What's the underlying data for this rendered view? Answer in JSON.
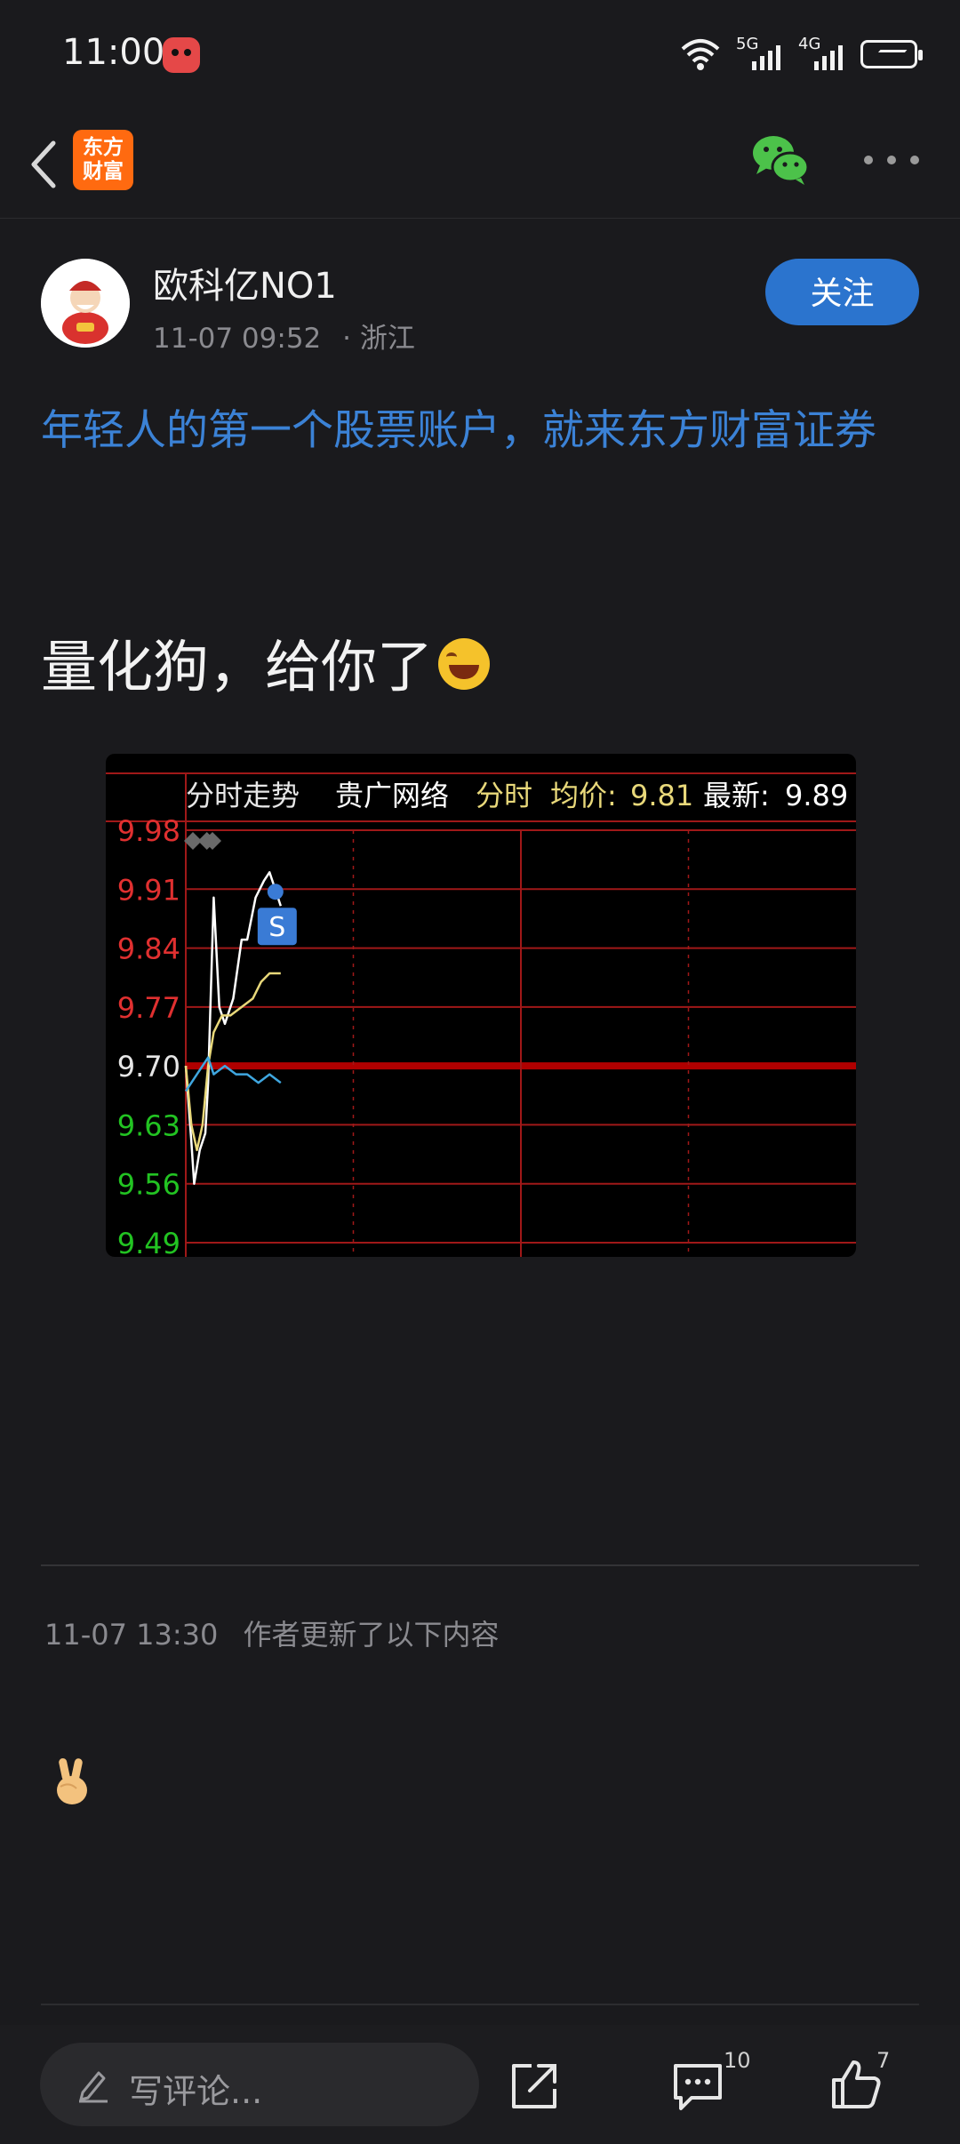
{
  "status_bar": {
    "time": "11:00",
    "network_1": "5G",
    "network_2": "4G"
  },
  "app_bar": {
    "logo_line1": "东方",
    "logo_line2": "财富",
    "brand_color": "#ff6a10"
  },
  "post": {
    "author_name": "欧科亿NO1",
    "timestamp": "11-07 09:52",
    "location": "· 浙江",
    "follow_label": "关注",
    "promo_link": "年轻人的第一个股票账户，就来东方财富证券",
    "body_text": "量化狗，给你了",
    "link_color": "#3b82d6"
  },
  "chart_data": {
    "type": "line",
    "title": "分时走势",
    "stock_name": "贵广网络",
    "mode_label": "分时",
    "avg_label": "均价:",
    "avg_value": "9.81",
    "latest_label": "最新:",
    "latest_value": "9.89",
    "trade_marker": "S",
    "y_ticks": [
      "9.98",
      "9.91",
      "9.84",
      "9.77",
      "9.70",
      "9.63",
      "9.56",
      "9.49"
    ],
    "reference_price": 9.7,
    "ylim": [
      9.49,
      9.98
    ],
    "x_range_minutes": [
      0,
      240
    ],
    "series": [
      {
        "color": "#ffffff",
        "x": [
          0,
          2,
          3,
          5,
          7,
          8,
          10,
          12,
          14,
          15,
          17,
          20,
          22,
          25,
          28,
          30,
          32,
          34
        ],
        "values": [
          9.7,
          9.61,
          9.56,
          9.6,
          9.62,
          9.68,
          9.9,
          9.77,
          9.75,
          9.76,
          9.78,
          9.85,
          9.85,
          9.9,
          9.92,
          9.93,
          9.91,
          9.89
        ]
      },
      {
        "color": "#e8d87a",
        "x": [
          0,
          2,
          4,
          6,
          8,
          10,
          13,
          16,
          20,
          24,
          27,
          30,
          34
        ],
        "values": [
          9.7,
          9.63,
          9.6,
          9.63,
          9.7,
          9.74,
          9.76,
          9.76,
          9.77,
          9.78,
          9.8,
          9.81,
          9.81
        ]
      },
      {
        "color": "#3fa7e0",
        "x": [
          0,
          4,
          8,
          10,
          14,
          18,
          22,
          26,
          30,
          34
        ],
        "values": [
          9.67,
          9.69,
          9.71,
          9.69,
          9.7,
          9.69,
          9.69,
          9.68,
          9.69,
          9.68
        ]
      }
    ]
  },
  "update": {
    "time": "11-07 13:30",
    "text": "作者更新了以下内容"
  },
  "bottom_bar": {
    "comment_placeholder": "写评论...",
    "comment_count": "10",
    "like_count": "7"
  }
}
